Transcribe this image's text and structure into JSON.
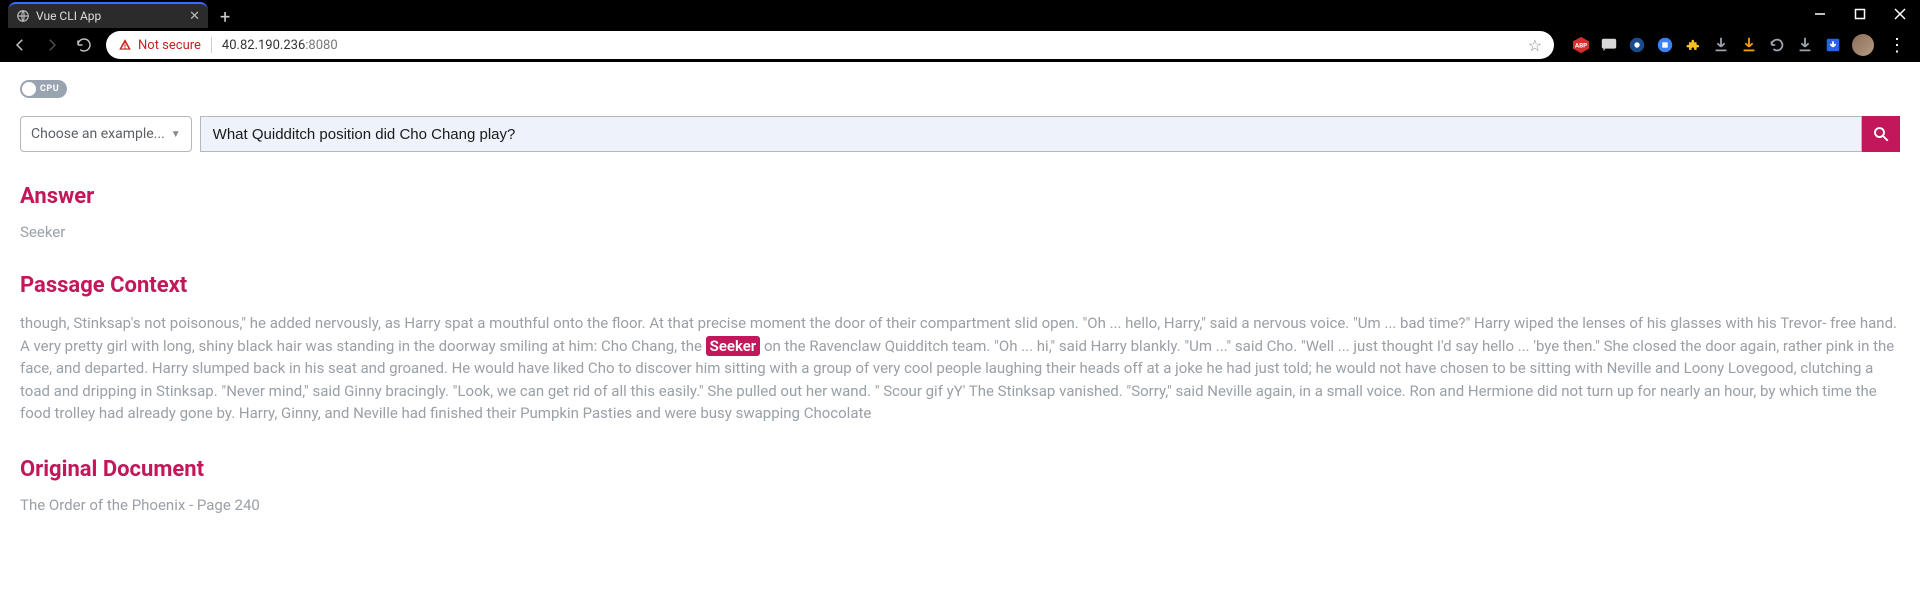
{
  "browser": {
    "tab_title": "Vue CLI App",
    "not_secure_label": "Not secure",
    "url_host": "40.82.190.236",
    "url_port": ":8080"
  },
  "toggle": {
    "label": "CPU"
  },
  "select": {
    "placeholder": "Choose an example..."
  },
  "question": {
    "value": "What Quidditch position did Cho Chang play?"
  },
  "sections": {
    "answer_h": "Answer",
    "passage_h": "Passage Context",
    "doc_h": "Original Document"
  },
  "answer": "Seeker",
  "passage_pre": "though, Stinksap's not poisonous,\" he added nervously, as Harry spat a mouthful onto the floor. At that precise moment the door of their compartment slid open. \"Oh ... hello, Harry,\" said a nervous voice. \"Um ... bad time?\" Harry wiped the lenses of his glasses with his Trevor- free hand. A very pretty girl with long, shiny black hair was standing in the doorway smiling at him: Cho Chang, the ",
  "passage_hl": "Seeker",
  "passage_post": " on the Ravenclaw Quidditch team. \"Oh ... hi,\" said Harry blankly. \"Um ...\" said Cho. \"Well ... just thought I'd say hello ... 'bye then.\" She closed the door again, rather pink in the face, and departed. Harry slumped back in his seat and groaned. He would have liked Cho to discover him sitting with a group of very cool people laughing their heads off at a joke he had just told; he would not have chosen to be sitting with Neville and Loony Lovegood, clutching a toad and dripping in Stinksap. \"Never mind,\" said Ginny bracingly. \"Look, we can get rid of all this easily.\" She pulled out her wand. \" Scour gif yY' The Stinksap vanished. \"Sorry,\" said Neville again, in a small voice. Ron and Hermione did not turn up for nearly an hour, by which time the food trolley had already gone by. Harry, Ginny, and Neville had finished their Pumpkin Pasties and were busy swapping Chocolate",
  "document": "The Order of the Phoenix - Page 240"
}
